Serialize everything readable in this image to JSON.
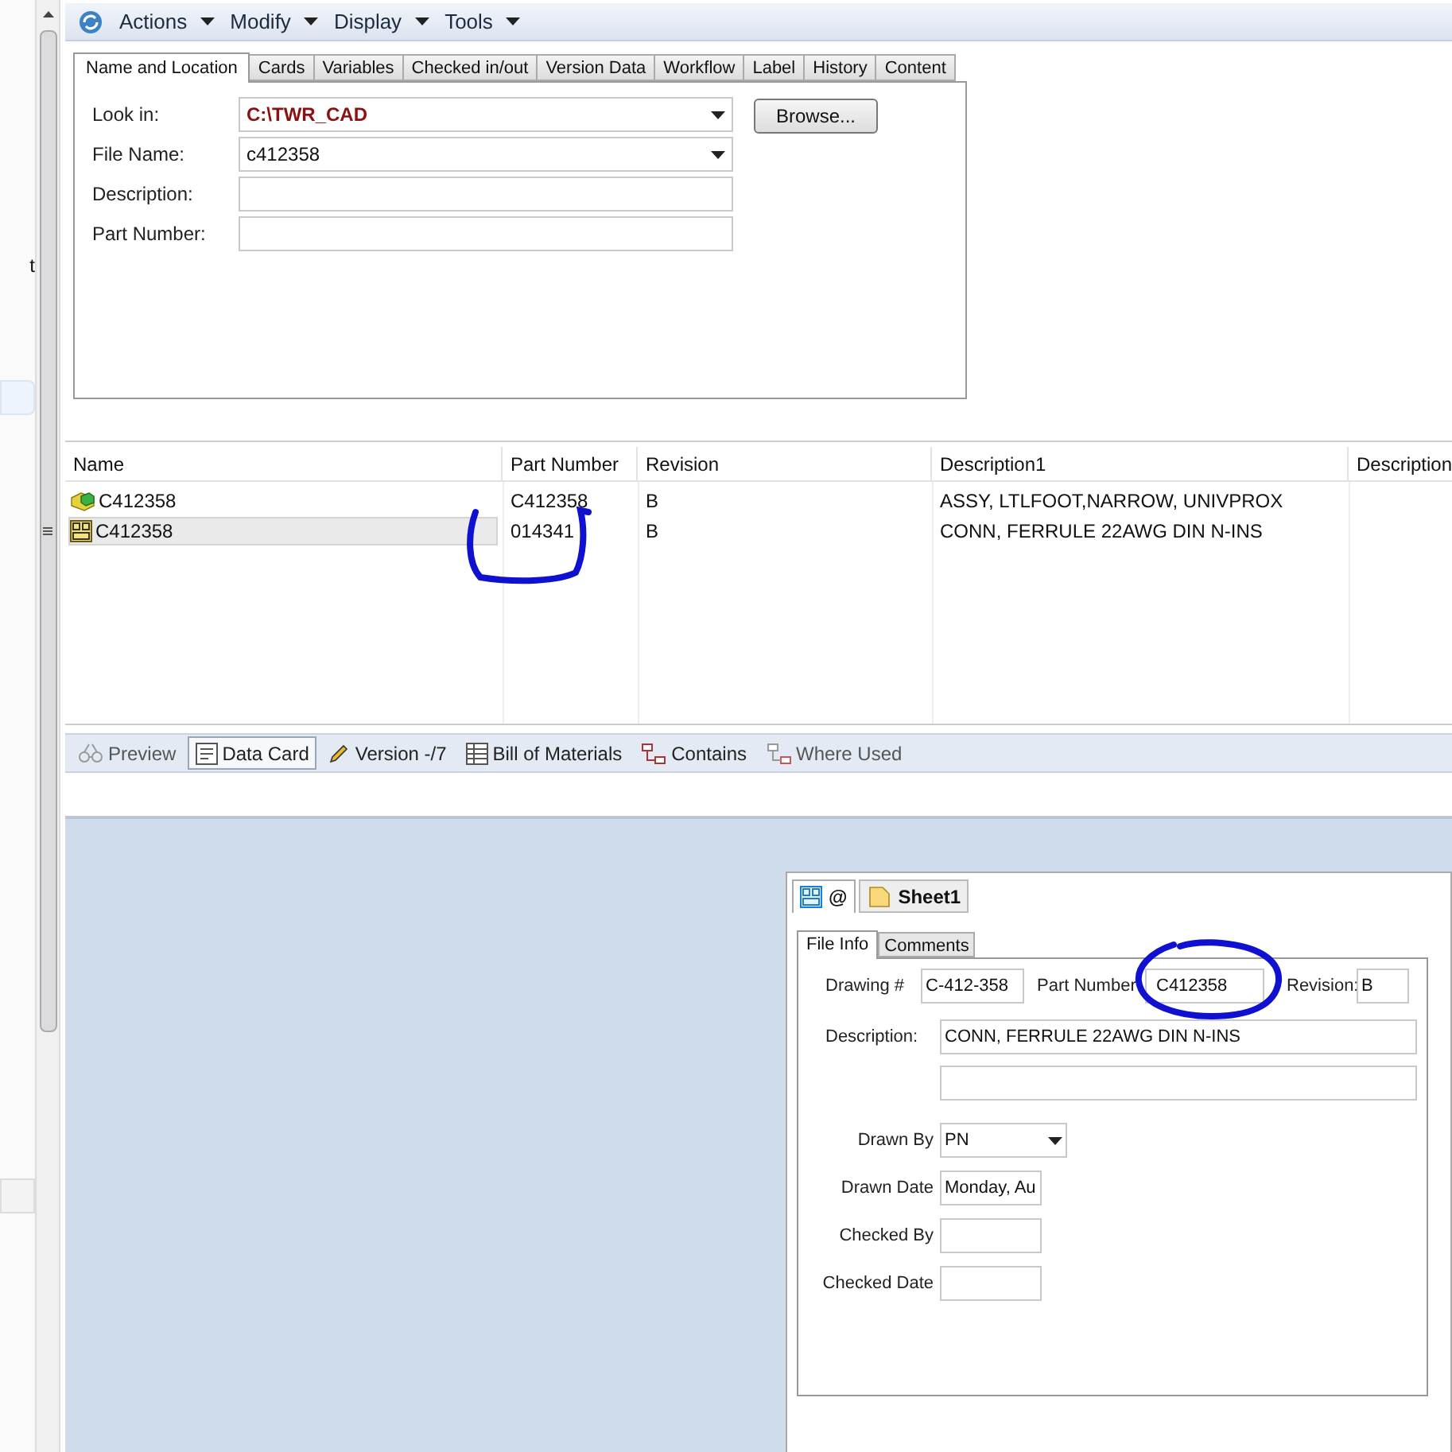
{
  "left_panel": {
    "text": "t"
  },
  "toolbar": {
    "menus": [
      "Actions",
      "Modify",
      "Display",
      "Tools"
    ]
  },
  "search_tabs": [
    {
      "label": "Name and Location",
      "selected": true
    },
    {
      "label": "Cards",
      "selected": false
    },
    {
      "label": "Variables",
      "selected": false
    },
    {
      "label": "Checked in/out",
      "selected": false
    },
    {
      "label": "Version Data",
      "selected": false
    },
    {
      "label": "Workflow",
      "selected": false
    },
    {
      "label": "Label",
      "selected": false
    },
    {
      "label": "History",
      "selected": false
    },
    {
      "label": "Content",
      "selected": false
    }
  ],
  "search_form": {
    "look_in": {
      "label": "Look in:",
      "value": "C:\\TWR_CAD"
    },
    "file_name": {
      "label": "File Name:",
      "value": "c412358"
    },
    "description": {
      "label": "Description:"
    },
    "part_number": {
      "label": "Part Number:"
    },
    "browse_button": "Browse..."
  },
  "results": {
    "columns": [
      "Name",
      "Part Number",
      "Revision",
      "Description1",
      "Description"
    ],
    "rows": [
      {
        "kind": "assembly",
        "name": "C412358",
        "part_number": "C412358",
        "revision": "B",
        "description1": "ASSY, LTLFOOT,NARROW, UNIVPROX",
        "selected": false
      },
      {
        "kind": "card",
        "name": "C412358",
        "part_number": "014341",
        "revision": "B",
        "description1": "CONN, FERRULE 22AWG DIN N-INS",
        "selected": true
      }
    ]
  },
  "view_tabs": [
    {
      "kind": "preview",
      "label": "Preview",
      "selected": false
    },
    {
      "kind": "card",
      "label": "Data Card",
      "selected": true
    },
    {
      "kind": "version",
      "label": "Version -/7",
      "selected": false
    },
    {
      "kind": "bom",
      "label": "Bill of Materials",
      "selected": false
    },
    {
      "kind": "contains",
      "label": "Contains",
      "selected": false
    },
    {
      "kind": "where",
      "label": "Where Used",
      "selected": false
    }
  ],
  "data_card": {
    "sheet_tabs": [
      {
        "kind": "card",
        "label": "@",
        "selected": true
      },
      {
        "kind": "sheet",
        "label": "Sheet1",
        "selected": false
      }
    ],
    "inner_tabs": [
      {
        "label": "File Info",
        "selected": true
      },
      {
        "label": "Comments",
        "selected": false
      }
    ],
    "drawing_no": {
      "label": "Drawing #",
      "value": "C-412-358"
    },
    "part_number": {
      "label": "Part Number",
      "value": "C412358"
    },
    "revision": {
      "label": "Revision:",
      "value": "B"
    },
    "description": {
      "label": "Description:",
      "value": "CONN, FERRULE 22AWG DIN N-INS"
    },
    "drawn_by": {
      "label": "Drawn By",
      "value": "PN"
    },
    "drawn_date": {
      "label": "Drawn Date",
      "value": "Monday, Au"
    },
    "checked_by": {
      "label": "Checked By"
    },
    "checked_date": {
      "label": "Checked Date"
    }
  }
}
